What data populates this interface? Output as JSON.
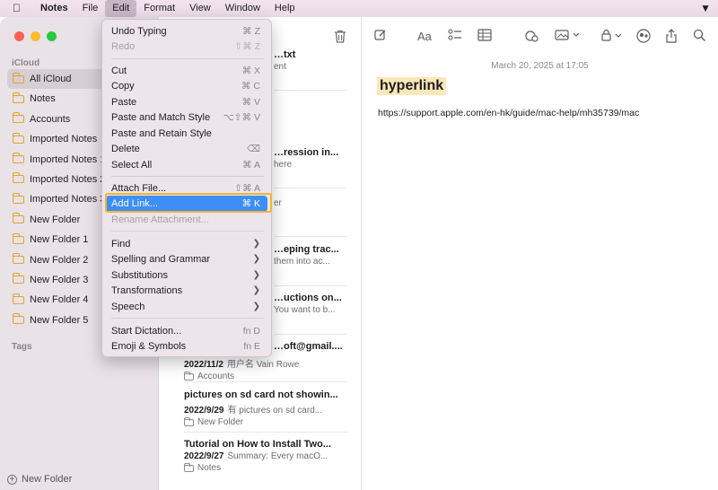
{
  "menubar": {
    "items": [
      "Notes",
      "File",
      "Edit",
      "Format",
      "View",
      "Window",
      "Help"
    ],
    "active": "Edit"
  },
  "sidebar": {
    "section_icloud": "iCloud",
    "folders": [
      "All iCloud",
      "Notes",
      "Accounts",
      "Imported Notes",
      "Imported Notes 1",
      "Imported Notes 2",
      "Imported Notes 3",
      "New Folder",
      "New Folder 1",
      "New Folder 2",
      "New Folder 3",
      "New Folder 4",
      "New Folder 5"
    ],
    "selected": "All iCloud",
    "section_tags": "Tags",
    "new_folder_label": "New Folder"
  },
  "notelist": {
    "partial": [
      {
        "ttl": "…txt",
        "sub": "ent"
      },
      {
        "ttl": "…ression in...",
        "sub": "here"
      },
      {
        "ttl": "",
        "sub": "er"
      },
      {
        "ttl": "…eping trac...",
        "sub": "them into ac..."
      },
      {
        "ttl": "…uctions on...",
        "sub": "You want to b..."
      },
      {
        "ttl": "…oft@gmail...."
      }
    ],
    "notes": [
      {
        "ttl": "",
        "date": "2022/11/2",
        "preview": "用户名 Vain Rowe",
        "folder": "Accounts"
      },
      {
        "ttl": "pictures on sd card not showin...",
        "date": "2022/9/29",
        "preview": "有 pictures on sd card...",
        "folder": "New Folder"
      },
      {
        "ttl": "Tutorial on How to Install Two...",
        "date": "2022/9/27",
        "preview": "Summary: Every macO...",
        "folder": "Notes"
      }
    ]
  },
  "editor": {
    "date": "March 20, 2025 at 17:05",
    "title": "hyperlink",
    "body": "https://support.apple.com/en-hk/guide/mac-help/mh35739/mac"
  },
  "edit_menu": {
    "undo": {
      "label": "Undo Typing",
      "sc": "⌘ Z"
    },
    "redo": {
      "label": "Redo",
      "sc": "⇧⌘ Z"
    },
    "cut": {
      "label": "Cut",
      "sc": "⌘ X"
    },
    "copy": {
      "label": "Copy",
      "sc": "⌘ C"
    },
    "paste": {
      "label": "Paste",
      "sc": "⌘ V"
    },
    "paste_match": {
      "label": "Paste and Match Style",
      "sc": "⌥⇧⌘ V"
    },
    "paste_retain": {
      "label": "Paste and Retain Style",
      "sc": ""
    },
    "delete": {
      "label": "Delete",
      "sc": "⌫"
    },
    "select_all": {
      "label": "Select All",
      "sc": "⌘ A"
    },
    "attach": {
      "label": "Attach File...",
      "sc": "⇧⌘ A"
    },
    "add_link": {
      "label": "Add Link...",
      "sc": "⌘ K"
    },
    "rename": {
      "label": "Rename Attachment...",
      "sc": ""
    },
    "find": {
      "label": "Find"
    },
    "spelling": {
      "label": "Spelling and Grammar"
    },
    "substitutions": {
      "label": "Substitutions"
    },
    "transformations": {
      "label": "Transformations"
    },
    "speech": {
      "label": "Speech"
    },
    "dictation": {
      "label": "Start Dictation...",
      "sc": "fn D"
    },
    "emoji": {
      "label": "Emoji & Symbols",
      "sc": "fn E"
    }
  },
  "icons": [
    "apple-icon",
    "trash-icon",
    "compose-icon",
    "format-icon",
    "checklist-icon",
    "table-icon",
    "attachment-icon",
    "media-icon",
    "lock-icon",
    "collaborate-icon",
    "share-icon",
    "search-icon"
  ]
}
